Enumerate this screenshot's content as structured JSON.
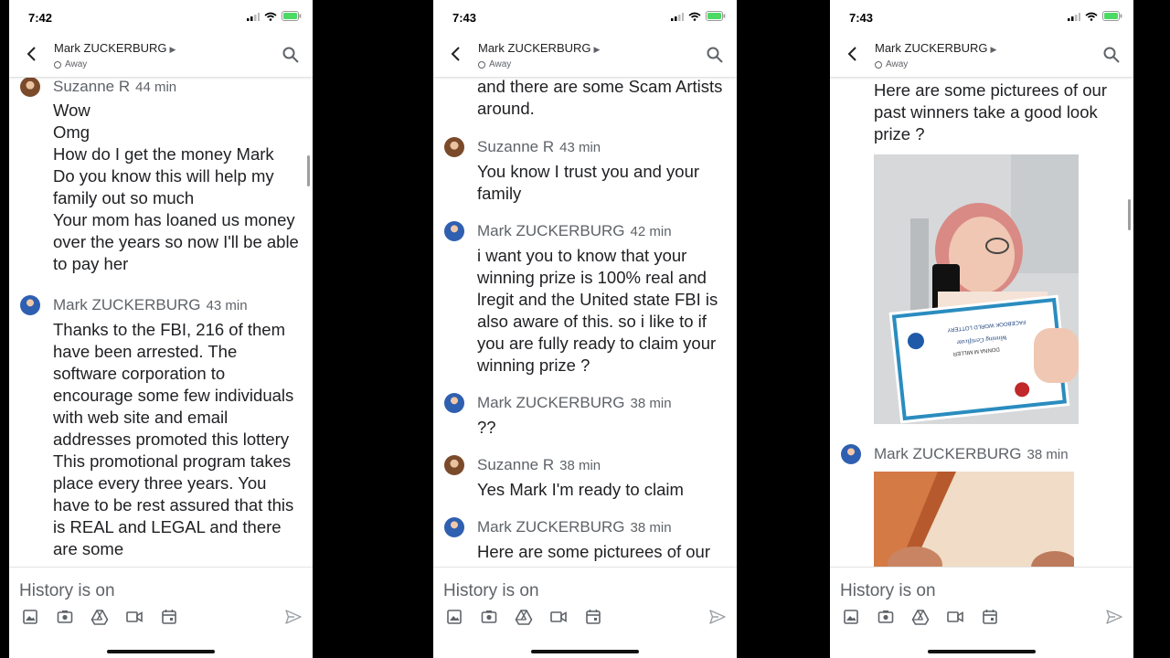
{
  "panels": [
    {
      "time": "7:42",
      "contact": "Mark ZUCKERBURG",
      "presence": "Away",
      "messages": [
        {
          "sender": "Suzanne R",
          "ago": "44 min",
          "text": "Wow\nOmg\nHow do I get the money Mark\nDo you know this will help my family out so much\nYour mom has loaned us money over the years so now I'll be able to pay her"
        },
        {
          "sender": "Mark ZUCKERBURG",
          "ago": "43 min",
          "text": "Thanks to the FBI, 216 of them have been arrested. The software corporation to encourage some few individuals with web site and email addresses promoted this lottery\nThis promotional program takes place every three years. You have to be rest assured that this is REAL and LEGAL and there are some"
        }
      ],
      "composer_placeholder": "History is on"
    },
    {
      "time": "7:43",
      "contact": "Mark ZUCKERBURG",
      "presence": "Away",
      "messages": [
        {
          "text": "and there are some Scam Artists around."
        },
        {
          "sender": "Suzanne R",
          "ago": "43 min",
          "text": "You know I trust you and your family"
        },
        {
          "sender": "Mark ZUCKERBURG",
          "ago": "42 min",
          "text": "i want you to know that your winning prize  is 100% real and lregit and the United state FBI is also aware of this. so i like to if you are fully ready to claim your winning prize ?"
        },
        {
          "sender": "Mark ZUCKERBURG",
          "ago": "38 min",
          "text": "??"
        },
        {
          "sender": "Suzanne R",
          "ago": "38 min",
          "text": "Yes Mark I'm ready to claim"
        },
        {
          "sender": "Mark ZUCKERBURG",
          "ago": "38 min",
          "text": "Here are some picturees of our"
        }
      ],
      "composer_placeholder": "History is on"
    },
    {
      "time": "7:43",
      "contact": "Mark ZUCKERBURG",
      "presence": "Away",
      "messages": [
        {
          "text": "Here are some picturees of our past winners take a good look prize ?"
        },
        {
          "sender": "Mark ZUCKERBURG",
          "ago": "38 min"
        }
      ],
      "certificate": {
        "brand": "FACEBOOK WORLD LOTTERY",
        "title": "Winning Certificate",
        "winner": "DONNA M MILLER"
      },
      "composer_placeholder": "History is on"
    }
  ]
}
